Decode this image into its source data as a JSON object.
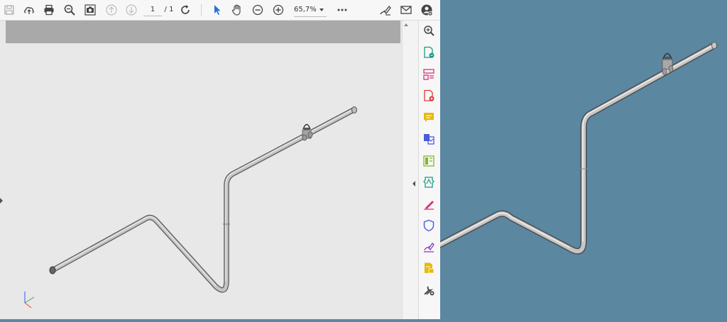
{
  "toolbar": {
    "page_current": "1",
    "page_separator_total": "/ 1",
    "zoom_value": "65,7%"
  },
  "icons": {
    "save": "save-icon",
    "upload": "cloud-upload-icon",
    "print": "print-icon",
    "zoom_search": "magnifier-icon",
    "snapshot": "camera-icon",
    "prev_page": "arrow-up-circle-icon",
    "next_page": "arrow-down-circle-icon",
    "rotate": "rotate-icon",
    "select": "cursor-icon",
    "hand": "hand-icon",
    "zoom_out": "zoom-out-icon",
    "zoom_in": "zoom-in-icon",
    "zoom_dropdown": "chevron-down-icon",
    "more": "more-icon",
    "sign": "sign-icon",
    "email": "email-icon",
    "account": "account-icon"
  },
  "tools_pane": [
    "zoom-tool-icon",
    "export-pdf-icon",
    "organize-pages-icon",
    "create-pdf-icon",
    "comment-icon",
    "combine-files-icon",
    "edit-pdf-icon",
    "acrobat-scan-icon",
    "fill-sign-icon",
    "protect-icon",
    "send-for-signature-icon",
    "send-comment-icon",
    "more-tools-icon"
  ],
  "colors": {
    "pdf_background": "#e8e8e8",
    "view3d_background": "#5b87a1",
    "pipe": "#b8b8b8",
    "accent_blue": "#2a6ee0"
  }
}
